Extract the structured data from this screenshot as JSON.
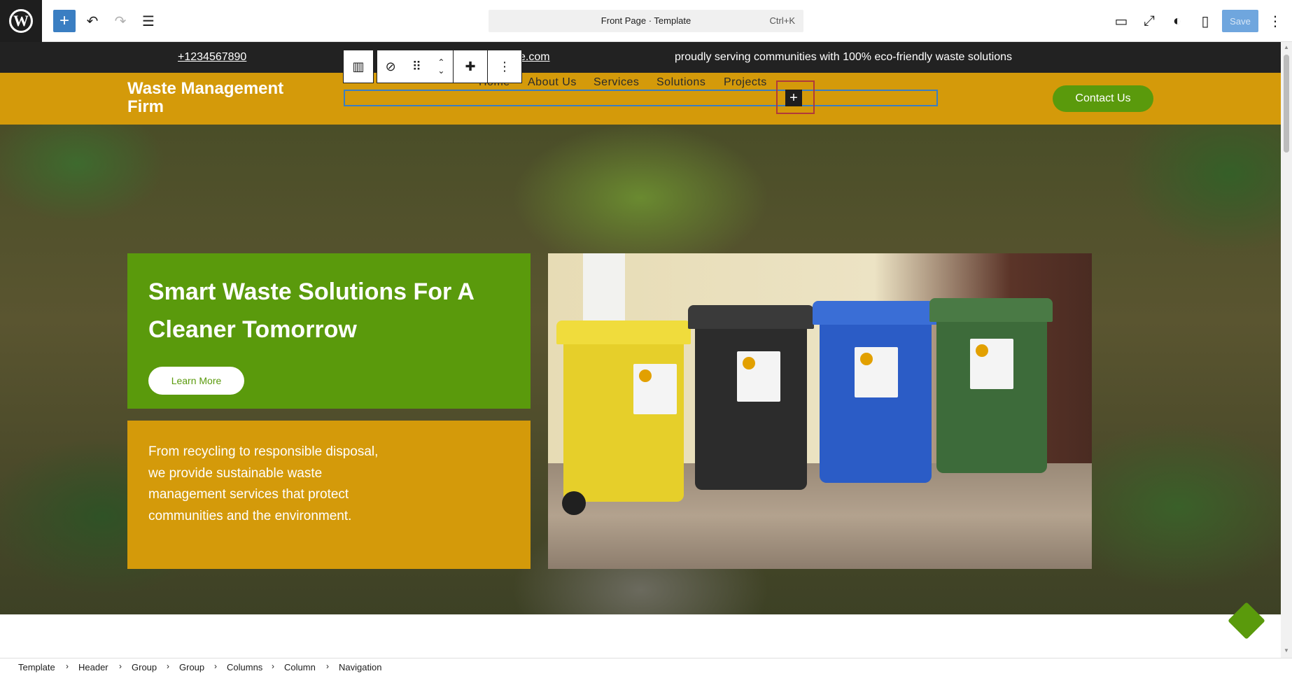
{
  "editor": {
    "logo": "W",
    "toolbar": {
      "add_label": "+",
      "undo_label": "↶",
      "redo_label": "↷",
      "list_view_label": "☰"
    },
    "command": {
      "title": "Front Page · Template",
      "shortcut": "Ctrl+K"
    },
    "right": {
      "preview_label": "▭",
      "fullscreen_label": "⤢",
      "styles_label": "◐",
      "settings_label": "▯",
      "save_label": "Save",
      "options_label": "⋮"
    }
  },
  "topstrip": {
    "phone": "+1234567890",
    "email_suffix": "e.com",
    "tagline": "proudly serving communities with 100% eco-friendly waste solutions"
  },
  "header": {
    "site_title": "Waste Management Firm",
    "nav": [
      "Home",
      "About Us",
      "Services",
      "Solutions",
      "Projects"
    ],
    "nav_add": "+",
    "contact_label": "Contact Us"
  },
  "block_toolbar": {
    "parent_icon": "▥",
    "nav_icon": "⊘",
    "drag_icon": "⠿",
    "move_up": "⌃",
    "move_down": "⌄",
    "justify_icon": "✚",
    "more_icon": "⋮"
  },
  "hero": {
    "heading": "Smart Waste Solutions For A Cleaner Tomorrow",
    "button": "Learn More",
    "body": "From recycling to responsible disposal, we provide sustainable waste management services that protect communities and the environment."
  },
  "breadcrumb": [
    "Template",
    "Header",
    "Group",
    "Group",
    "Columns",
    "Column",
    "Navigation"
  ],
  "colors": {
    "amber": "#d49a0a",
    "green": "#5a9a0c",
    "dark": "#222222",
    "wp_blue": "#3a7ec2"
  }
}
